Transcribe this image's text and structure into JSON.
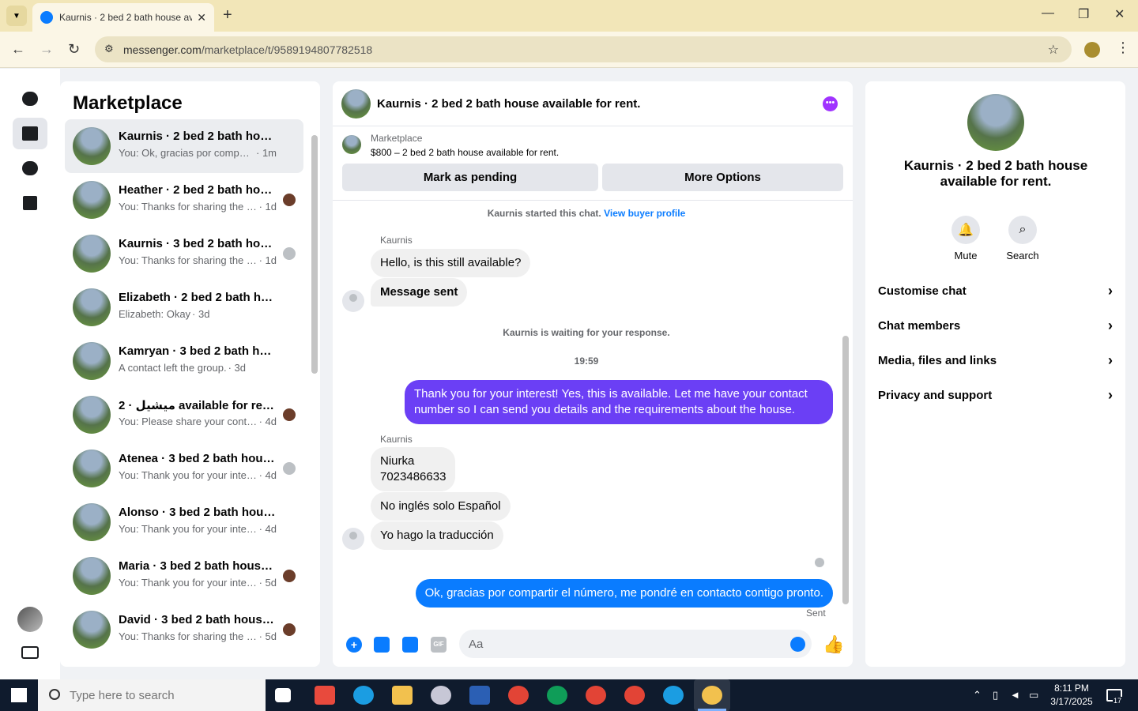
{
  "browser": {
    "tab_title": "Kaurnis · 2 bed 2 bath house av",
    "url_host": "messenger.com",
    "url_path": "/marketplace/t/9589194807782518"
  },
  "list": {
    "title": "Marketplace",
    "conversations": [
      {
        "name": "Kaurnis · 2 bed 2 bath hous...",
        "preview": "You: Ok, gracias por compart...",
        "time": "· 1m"
      },
      {
        "name": "Heather · 2 bed 2 bath hou...",
        "preview": "You: Thanks for sharing the n...",
        "time": "· 1d"
      },
      {
        "name": "Kaurnis · 3 bed 2 bath hous...",
        "preview": "You: Thanks for sharing the n...",
        "time": "· 1d"
      },
      {
        "name": "Elizabeth · 2 bed 2 bath ho...",
        "preview": "Elizabeth: Okay",
        "time": "· 3d"
      },
      {
        "name": "Kamryan · 3 bed 2 bath ho...",
        "preview": "A contact left the group.",
        "time": "· 3d"
      },
      {
        "name": "ميشيل · 2 available for rent ...",
        "preview": "You: Please share your contac...",
        "time": "· 4d"
      },
      {
        "name": "Atenea · 3 bed 2 bath hous...",
        "preview": "You: Thank you for your inter...",
        "time": "· 4d"
      },
      {
        "name": "Alonso · 3 bed 2 bath hous...",
        "preview": "You: Thank you for your inter...",
        "time": "· 4d"
      },
      {
        "name": "Maria · 3 bed 2 bath house...",
        "preview": "You: Thank you for your inter...",
        "time": "· 5d"
      },
      {
        "name": "David · 3 bed 2 bath house...",
        "preview": "You: Thanks for sharing the n...",
        "time": "· 5d"
      }
    ]
  },
  "chat": {
    "title": "Kaurnis · 2 bed 2 bath house available for rent.",
    "marketplace_label": "Marketplace",
    "listing": "$800 – 2 bed 2 bath house available for rent.",
    "mark_pending": "Mark as pending",
    "more_options": "More Options",
    "started_text": "Kaurnis started this chat.",
    "view_profile": "View buyer profile",
    "sender1": "Kaurnis",
    "msg1": "Hello, is this still available?",
    "msg2": "Message sent",
    "waiting": "Kaurnis is waiting for your response.",
    "time_stamp": "19:59",
    "out1": "Thank you for your interest! Yes, this is available. Let me have your contact number so I can send you details and the requirements about the house.",
    "sender2": "Kaurnis",
    "msg3_line1": "Niurka",
    "msg3_line2": "7023486633",
    "msg4": "No inglés solo Español",
    "msg5": "Yo hago la traducción",
    "out2": "Ok, gracias por compartir el número, me pondré en contacto contigo pronto.",
    "sent": "Sent",
    "composer_placeholder": "Aa",
    "gif": "GIF"
  },
  "details": {
    "title": "Kaurnis · 2 bed 2 bath house available for rent.",
    "mute": "Mute",
    "search": "Search",
    "rows": [
      "Customise chat",
      "Chat members",
      "Media, files and links",
      "Privacy and support"
    ]
  },
  "taskbar": {
    "search_placeholder": "Type here to search",
    "time": "8:11 PM",
    "date": "3/17/2025",
    "notifications": "17"
  }
}
